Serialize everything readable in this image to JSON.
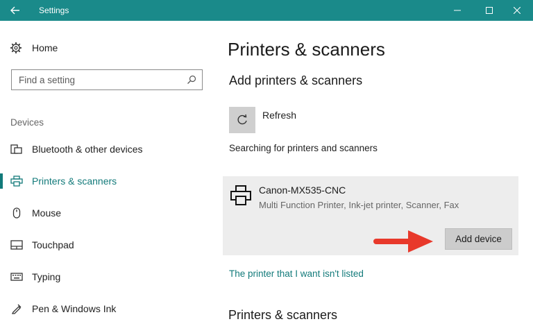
{
  "window": {
    "title": "Settings",
    "colors": {
      "titlebar": "#1a8a8a",
      "accent": "#127a7a",
      "arrow": "#e8392b"
    }
  },
  "sidebar": {
    "home_label": "Home",
    "search": {
      "placeholder": "Find a setting"
    },
    "section": "Devices",
    "items": [
      {
        "label": "Bluetooth & other devices",
        "icon": "bluetooth-devices-icon",
        "active": false
      },
      {
        "label": "Printers & scanners",
        "icon": "printer-icon",
        "active": true
      },
      {
        "label": "Mouse",
        "icon": "mouse-icon",
        "active": false
      },
      {
        "label": "Touchpad",
        "icon": "touchpad-icon",
        "active": false
      },
      {
        "label": "Typing",
        "icon": "keyboard-icon",
        "active": false
      },
      {
        "label": "Pen & Windows Ink",
        "icon": "pen-icon",
        "active": false
      }
    ]
  },
  "main": {
    "title": "Printers & scanners",
    "add_heading": "Add printers & scanners",
    "refresh_label": "Refresh",
    "searching_text": "Searching for printers and scanners",
    "device": {
      "name": "Canon-MX535-CNC",
      "description": "Multi Function Printer, Ink-jet printer, Scanner, Fax",
      "add_button": "Add device"
    },
    "not_listed_link": "The printer that I want isn't listed",
    "list_heading": "Printers & scanners"
  }
}
